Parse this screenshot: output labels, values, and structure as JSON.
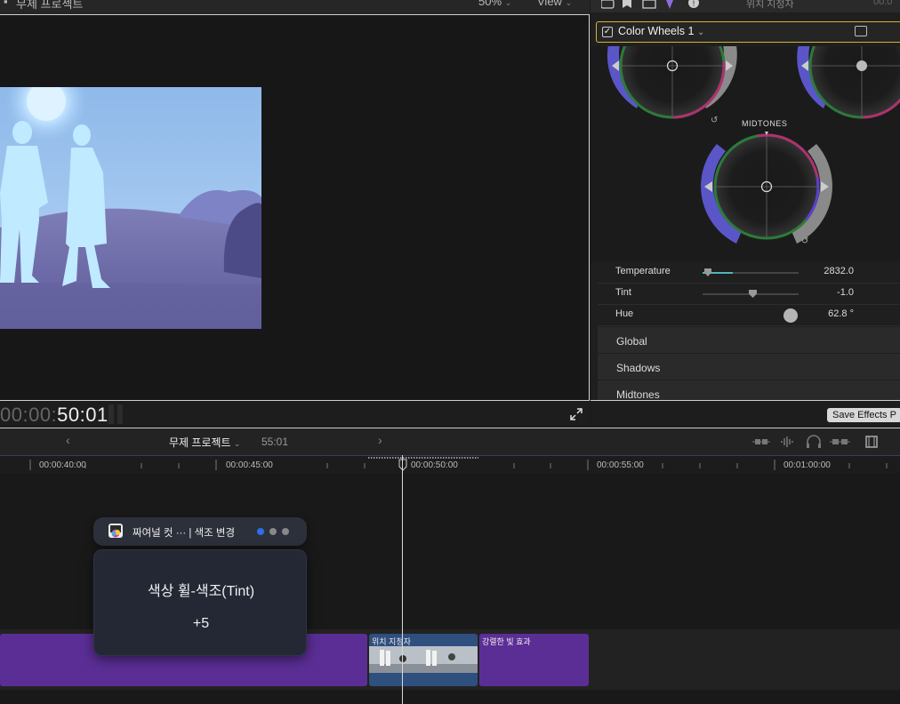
{
  "viewer": {
    "project_title": "무제 프로젝트",
    "zoom": "50%",
    "view_menu": "View",
    "timecode_dim": "00:00:",
    "timecode_main": "50:01"
  },
  "inspector": {
    "title": "위치 지정자",
    "timecode": "00:0",
    "effect_name": "Color Wheels 1",
    "effect_enabled": true,
    "midtones_label": "MIDTONES",
    "sliders": [
      {
        "label": "Temperature",
        "value": "2832.0"
      },
      {
        "label": "Tint",
        "value": "-1.0"
      },
      {
        "label": "Hue",
        "value": "62.8 °"
      }
    ],
    "sections": [
      "Global",
      "Shadows",
      "Midtones"
    ],
    "save_button": "Save Effects P"
  },
  "timeline": {
    "project_name": "무제 프로젝트",
    "duration": "55:01",
    "nav_prev": "‹",
    "nav_next": "›",
    "ruler_labels": [
      "00:00:40:00",
      "00:00:45:00",
      "00:00:50:00",
      "00:00:55:00",
      "00:01:00:00"
    ],
    "clips": [
      {
        "label": "위치 지정자"
      },
      {
        "label": "강렬한 빛 효과"
      }
    ]
  },
  "notification": {
    "title": "짜여널 컷 ··· | 색조 변경",
    "parameter": "색상 휠-색조(Tint)",
    "value": "+5"
  },
  "colors": {
    "accent_yellow": "#d4b23c",
    "clip_purple": "#5b2e96",
    "clip_blue": "#2f4f7e",
    "sky": "#9fc8f2"
  }
}
